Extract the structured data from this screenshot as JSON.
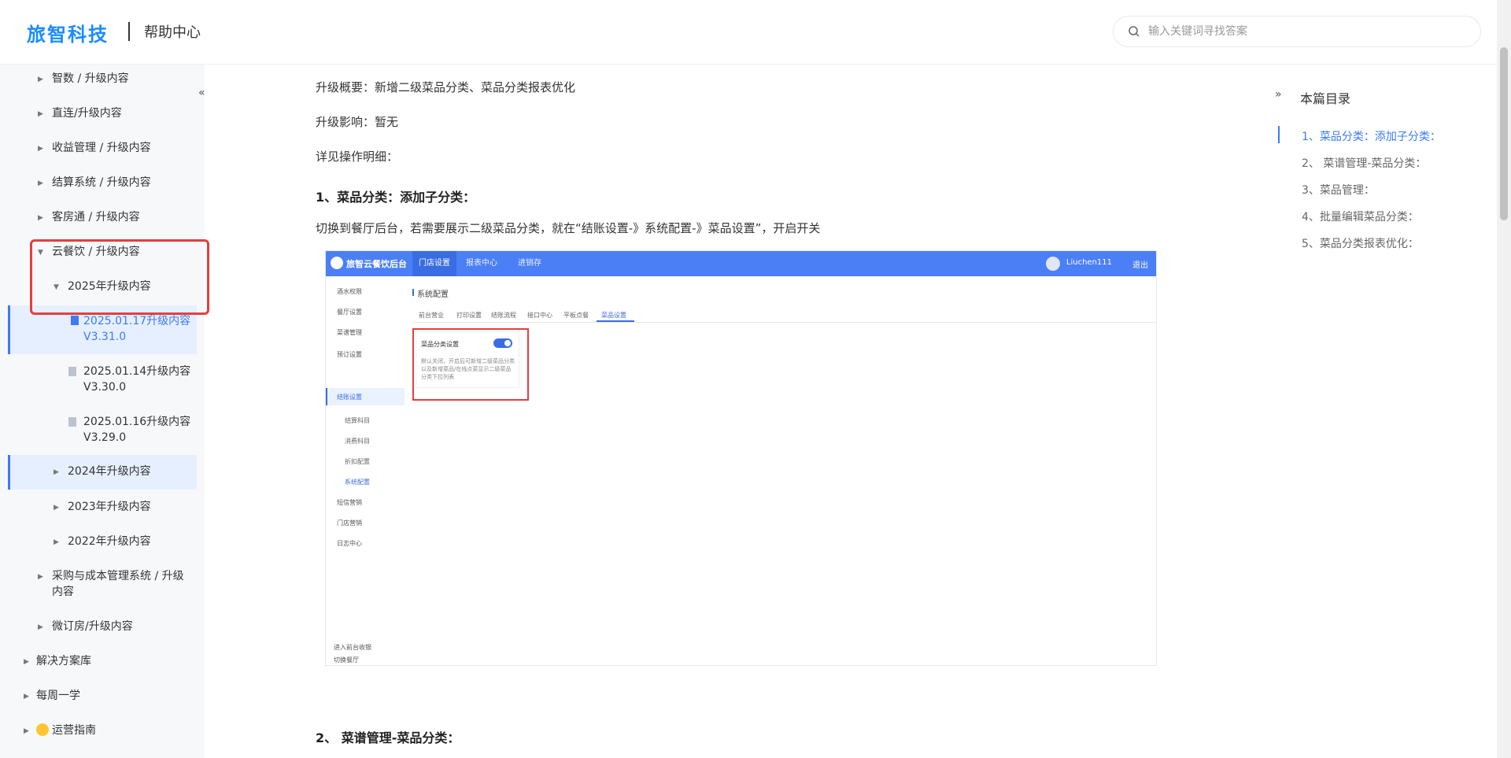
{
  "header": {
    "logo": "旅智科技",
    "help_title": "帮助中心",
    "search_placeholder": "输入关键词寻找答案"
  },
  "sidebar": {
    "items": [
      {
        "label": "智数 / 升级内容"
      },
      {
        "label": "直连/升级内容"
      },
      {
        "label": "收益管理 / 升级内容"
      },
      {
        "label": "结算系统 / 升级内容"
      },
      {
        "label": "客房通 / 升级内容"
      },
      {
        "label": "云餐饮 / 升级内容"
      },
      {
        "label": "2025年升级内容"
      },
      {
        "label": "2025.01.17升级内容 V3.31.0",
        "l1": "2025.01.17升级内容",
        "l2": "V3.31.0"
      },
      {
        "label": "2025.01.14升级内容 V3.30.0",
        "l1": "2025.01.14升级内容",
        "l2": "V3.30.0"
      },
      {
        "label": "2025.01.16升级内容 V3.29.0",
        "l1": "2025.01.16升级内容",
        "l2": "V3.29.0"
      },
      {
        "label": "2024年升级内容"
      },
      {
        "label": "2023年升级内容"
      },
      {
        "label": "2022年升级内容"
      },
      {
        "label": "采购与成本管理系统 / 升级内容",
        "l1": "采购与成本管理系统 / 升级",
        "l2": "内容"
      },
      {
        "label": "微订房/升级内容"
      },
      {
        "label": "解决方案库"
      },
      {
        "label": "每周一学"
      },
      {
        "label": "运营指南"
      }
    ]
  },
  "content": {
    "overview": "升级概要：新增二级菜品分类、菜品分类报表优化",
    "impact": "升级影响：暂无",
    "details": "详见操作明细：",
    "section1_title": "1、菜品分类：添加子分类：",
    "section1_text": "切换到餐厅后台，若需要展示二级菜品分类，就在“结账设置-》系统配置-》菜品设置”，开启开关",
    "section2_title": "2、 菜谱管理-菜品分类："
  },
  "screenshot": {
    "brand": "旅智云餐饮后台",
    "tabs": [
      "门店设置",
      "报表中心",
      "进销存"
    ],
    "user": "Liuchen111",
    "logout": "退出",
    "menu": [
      "酒水权限",
      "餐厅设置",
      "菜谱管理",
      "预订设置",
      "结账设置",
      "短信营销",
      "门店营销",
      "日志中心"
    ],
    "submenu": [
      "结算科目",
      "消费科目",
      "折扣配置",
      "系统配置"
    ],
    "page_title": "系统配置",
    "subtabs": [
      "前台营业",
      "打印设置",
      "结账流程",
      "接口中心",
      "平板点餐",
      "菜品设置"
    ],
    "card_title": "菜品分类设置",
    "card_desc": "默认关闭，开启后可新增二级菜品分类以及新增菜品/在线点菜显示二级菜品分类下拉列表",
    "footer": [
      "进入前台收银",
      "切换餐厅"
    ]
  },
  "toc": {
    "title": "本篇目录",
    "items": [
      "1、菜品分类：添加子分类：",
      "2、 菜谱管理-菜品分类：",
      "3、菜品管理：",
      "4、批量编辑菜品分类：",
      "5、菜品分类报表优化："
    ]
  }
}
